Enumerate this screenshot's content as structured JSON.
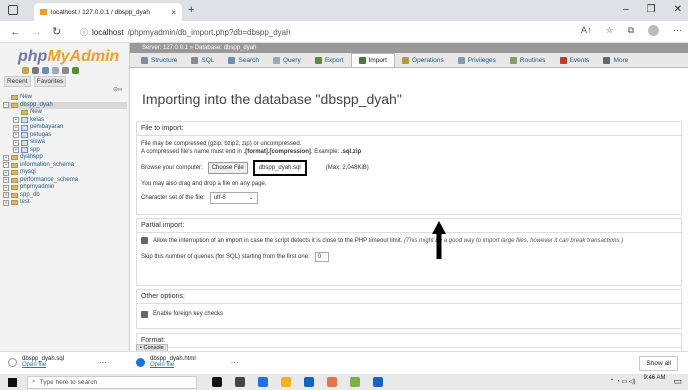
{
  "browser": {
    "tab_title": "localhost / 127.0.0.1 / dbspp_dyah",
    "url_host": "localhost",
    "url_path": "/phpmyadmin/db_import.php?db=dbspp_dyah"
  },
  "sidebar": {
    "logo_php": "php",
    "logo_myadmin": "MyAdmin",
    "tab_recent": "Recent",
    "tab_favorites": "Favorites",
    "tree": [
      {
        "label": "New",
        "level": 0,
        "type": "new"
      },
      {
        "label": "dbspp_dyah",
        "level": 0,
        "type": "db",
        "expanded": true
      },
      {
        "label": "New",
        "level": 1,
        "type": "new"
      },
      {
        "label": "kelas",
        "level": 1,
        "type": "table"
      },
      {
        "label": "pembayaran",
        "level": 1,
        "type": "table"
      },
      {
        "label": "petugas",
        "level": 1,
        "type": "table"
      },
      {
        "label": "siswa",
        "level": 1,
        "type": "table"
      },
      {
        "label": "spp",
        "level": 1,
        "type": "table"
      },
      {
        "label": "dyahspp",
        "level": 0,
        "type": "db"
      },
      {
        "label": "information_schema",
        "level": 0,
        "type": "db"
      },
      {
        "label": "mysql",
        "level": 0,
        "type": "db"
      },
      {
        "label": "performance_schema",
        "level": 0,
        "type": "db"
      },
      {
        "label": "phpmyadmin",
        "level": 0,
        "type": "db"
      },
      {
        "label": "spp_db",
        "level": 0,
        "type": "db"
      },
      {
        "label": "test",
        "level": 0,
        "type": "db"
      }
    ]
  },
  "main": {
    "breadcrumb": "Server: 127.0.0.1 » Database: dbspp_dyah",
    "menu": [
      {
        "label": "Structure",
        "color": "#7a8ea8"
      },
      {
        "label": "SQL",
        "color": "#8a8a8a"
      },
      {
        "label": "Search",
        "color": "#6f8fb0"
      },
      {
        "label": "Query",
        "color": "#9aa8b8"
      },
      {
        "label": "Export",
        "color": "#5b8c3e"
      },
      {
        "label": "Import",
        "color": "#4a7a3a",
        "active": true
      },
      {
        "label": "Operations",
        "color": "#b39a45"
      },
      {
        "label": "Privileges",
        "color": "#8899aa"
      },
      {
        "label": "Routines",
        "color": "#8a9a6a"
      },
      {
        "label": "Events",
        "color": "#c0392b"
      },
      {
        "label": "More",
        "color": "#666666"
      }
    ],
    "title": "Importing into the database \"dbspp_dyah\"",
    "file_section": {
      "legend": "File to import:",
      "line1": "File may be compressed (gzip, bzip2, zip) or uncompressed.",
      "line2_a": "A compressed file's name must end in ",
      "line2_b": ".[format].[compression]",
      "line2_c": ". Example: ",
      "line2_d": ".sql.zip",
      "browse_label": "Browse your computer:",
      "choose_button": "Choose File",
      "file_name": "dbspp_dyah.sql",
      "max_size": "(Max: 2,048KiB)",
      "drag_hint": "You may also drag and drop a file on any page.",
      "charset_label": "Character set of the file:",
      "charset_value": "utf-8"
    },
    "partial_section": {
      "legend": "Partial import:",
      "allow_text": "Allow the interruption of an import in case the script detects it is close to the PHP timeout limit.",
      "allow_hint": "(This might be a good way to import large files, however it can break transactions.)",
      "skip_label": "Skip this number of queries (for SQL) starting from the first one:",
      "skip_value": "0"
    },
    "other_section": {
      "legend": "Other options:",
      "fk_label": "Enable foreign key checks"
    },
    "format_legend": "Format:",
    "console_label": "Console"
  },
  "downloads": [
    {
      "name": "dbspp_dyah.sql",
      "open": "Open file",
      "color": "#e0e0e0"
    },
    {
      "name": "dbspp_dyah.html",
      "open": "Open file",
      "color": "#1a73e8"
    }
  ],
  "show_all": "Show all",
  "taskbar": {
    "search_placeholder": "Type here to search",
    "time": "9:46 AM",
    "apps_colors": [
      "#111111",
      "#444444",
      "#1a73e8",
      "#f2b01e",
      "#0a66c2",
      "#e8734a",
      "#7cb342",
      "#1565c0"
    ]
  }
}
